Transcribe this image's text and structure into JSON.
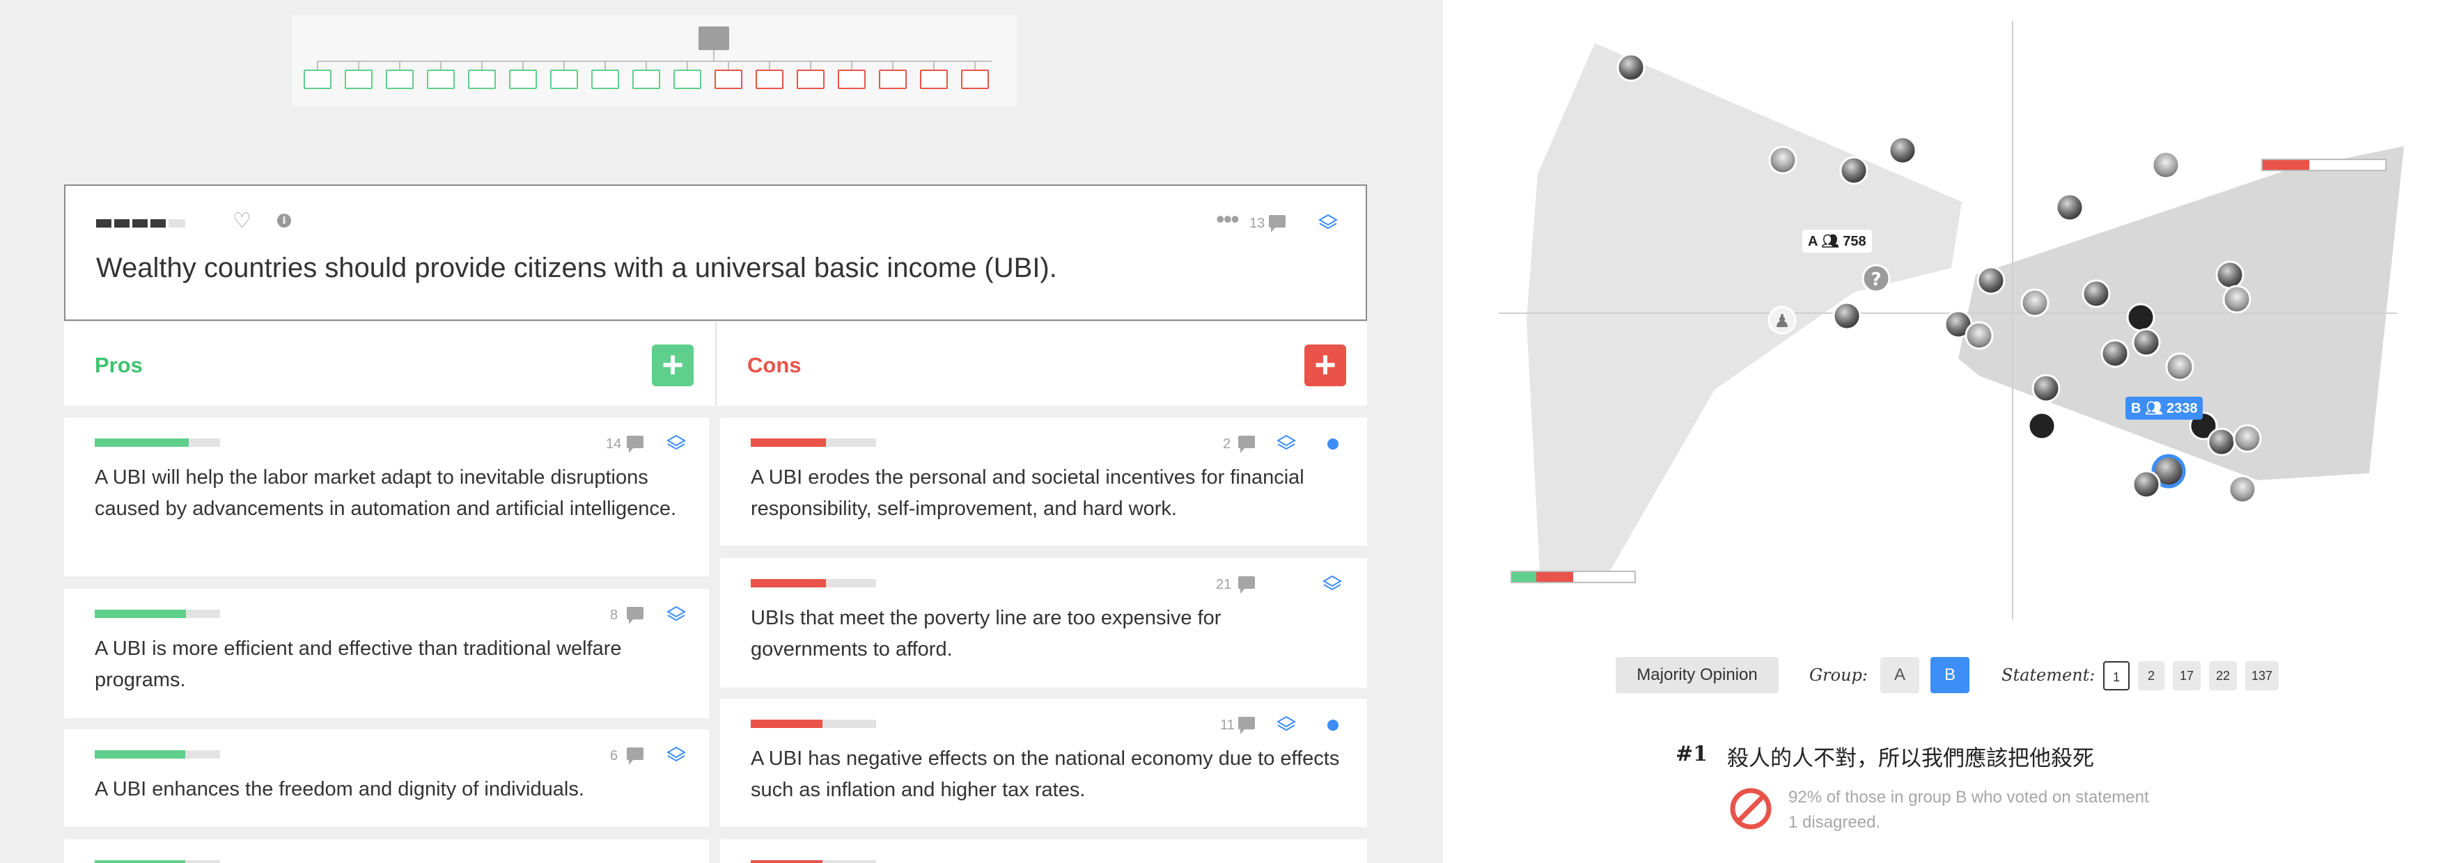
{
  "colors": {
    "pro": "#5fcf8c",
    "con": "#e9534a",
    "pro_title": "#3ec26f",
    "con_title": "#e9534a",
    "accent_blue": "#3d8ef7",
    "bar_empty": "#e3e3e3",
    "thesis_bar": "#3a3a3a"
  },
  "tree": {
    "pro_nodes": 10,
    "con_nodes": 7
  },
  "thesis": {
    "text": "Wealthy countries should provide citizens with a universal basic income (UBI).",
    "rating": 0.7,
    "comment_count": "13",
    "icons": [
      "heart-icon",
      "info-icon",
      "more-icon",
      "comment-icon",
      "layers-icon"
    ]
  },
  "pros": {
    "title": "Pros",
    "add_label": "+",
    "claims": [
      {
        "text": "A UBI will help the labor market adapt to inevitable disruptions caused by advancements in automation and artificial intelligence.",
        "rating": 0.75,
        "comments": "14"
      },
      {
        "text": "A UBI is more efficient and effective than traditional welfare programs.",
        "rating": 0.73,
        "comments": "8"
      },
      {
        "text": "A UBI enhances the freedom and dignity of individuals.",
        "rating": 0.72,
        "comments": "6"
      }
    ]
  },
  "cons": {
    "title": "Cons",
    "add_label": "+",
    "claims": [
      {
        "text": "A UBI erodes the personal and societal incentives for financial responsibility, self-improvement, and hard work.",
        "rating": 0.6,
        "comments": "2",
        "unread": true
      },
      {
        "text": "UBIs that meet the poverty line are too expensive for governments to afford.",
        "rating": 0.6,
        "comments": "21",
        "unread": false
      },
      {
        "text": "A UBI has negative effects on the national economy due to effects such as inflation and higher tax rates.",
        "rating": 0.57,
        "comments": "11",
        "unread": true
      }
    ]
  },
  "opinion_map": {
    "group_a": {
      "label": "A",
      "count": "758"
    },
    "group_b": {
      "label": "B",
      "count": "2338"
    },
    "group_a_vote": {
      "agree": 0.2,
      "disagree": 0.3
    },
    "group_b_vote": {
      "agree": 0.0,
      "disagree": 0.38
    },
    "participant_icon": "person-icon",
    "unknown_label": "?"
  },
  "controls": {
    "majority_label": "Majority Opinion",
    "group_label": "Group:",
    "groups": [
      "A",
      "B"
    ],
    "selected_group": "B",
    "statement_label": "Statement:",
    "statements": [
      "1",
      "2",
      "17",
      "22",
      "137"
    ],
    "selected_statement": "1"
  },
  "statement": {
    "number": "#1",
    "text": "殺人的人不對，所以我們應該把他殺死",
    "explanation": "92% of those in group B who voted on statement 1 disagreed.",
    "icon": "prohibited-icon"
  }
}
